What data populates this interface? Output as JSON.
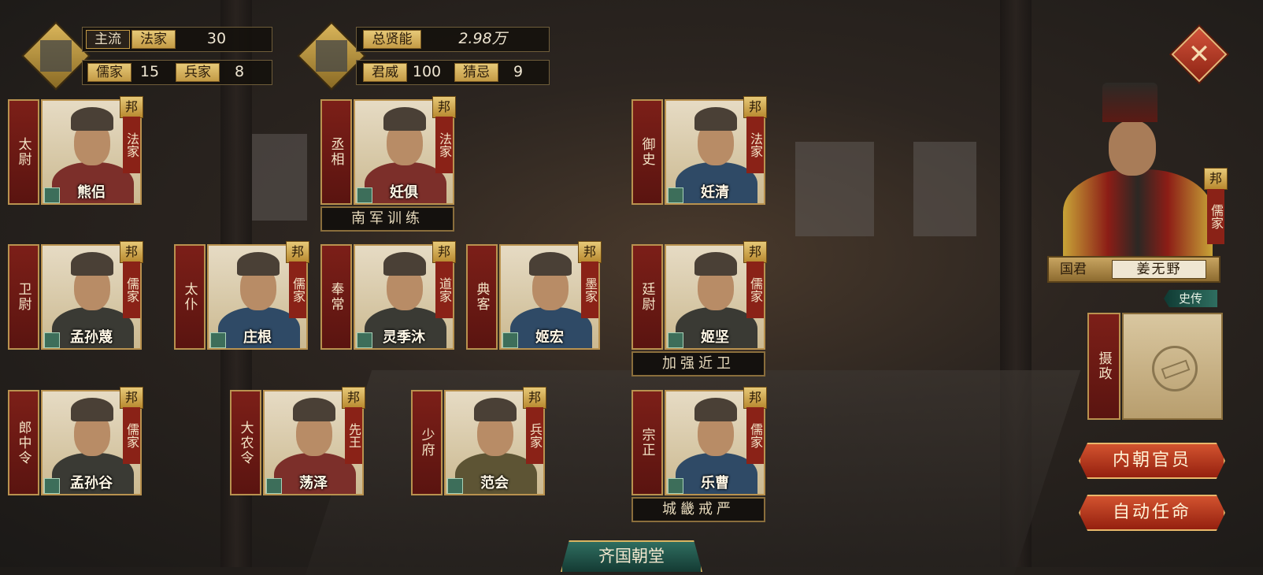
{
  "stats_left": {
    "mainstream_label": "主流",
    "mainstream_school": "法家",
    "mainstream_value": "30",
    "confucian_label": "儒家",
    "confucian_value": "15",
    "military_label": "兵家",
    "military_value": "8"
  },
  "stats_right": {
    "talent_label": "总贤能",
    "talent_value": "2.98万",
    "authority_label": "君威",
    "authority_value": "100",
    "suspicion_label": "猜忌",
    "suspicion_value": "9"
  },
  "officials": [
    {
      "title": "太尉",
      "name": "熊侣",
      "school": "法家",
      "badge": "邦"
    },
    {
      "title": "丞相",
      "name": "妊俱",
      "school": "法家",
      "badge": "邦",
      "policy": "南军训练"
    },
    {
      "title": "御史",
      "name": "妊清",
      "school": "法家",
      "badge": "邦"
    },
    {
      "title": "卫尉",
      "name": "孟孙蔑",
      "school": "儒家",
      "badge": "邦"
    },
    {
      "title": "太仆",
      "name": "庄根",
      "school": "儒家",
      "badge": "邦"
    },
    {
      "title": "奉常",
      "name": "灵季沐",
      "school": "道家",
      "badge": "邦"
    },
    {
      "title": "典客",
      "name": "姬宏",
      "school": "墨家",
      "badge": "邦"
    },
    {
      "title": "廷尉",
      "name": "姬坚",
      "school": "儒家",
      "badge": "邦",
      "policy": "加强近卫"
    },
    {
      "title": "郎中令",
      "name": "孟孙谷",
      "school": "儒家",
      "badge": "邦"
    },
    {
      "title": "大农令",
      "name": "荡泽",
      "school": "先王",
      "badge": "邦"
    },
    {
      "title": "少府",
      "name": "范会",
      "school": "兵家",
      "badge": "邦"
    },
    {
      "title": "宗正",
      "name": "乐曹",
      "school": "儒家",
      "badge": "邦",
      "policy": "城畿戒严"
    }
  ],
  "ruler": {
    "badge": "邦",
    "school": "儒家",
    "role": "国君",
    "name": "姜无野",
    "biography": "史传"
  },
  "regent": {
    "label": "摄政"
  },
  "buttons": {
    "inner_court": "内朝官员",
    "auto_appoint": "自动任命"
  },
  "court_title": "齐国朝堂",
  "icons": {
    "close": "close-icon",
    "stats_left": "bamboo-scroll-icon",
    "stats_right": "bronze-vessel-icon"
  }
}
